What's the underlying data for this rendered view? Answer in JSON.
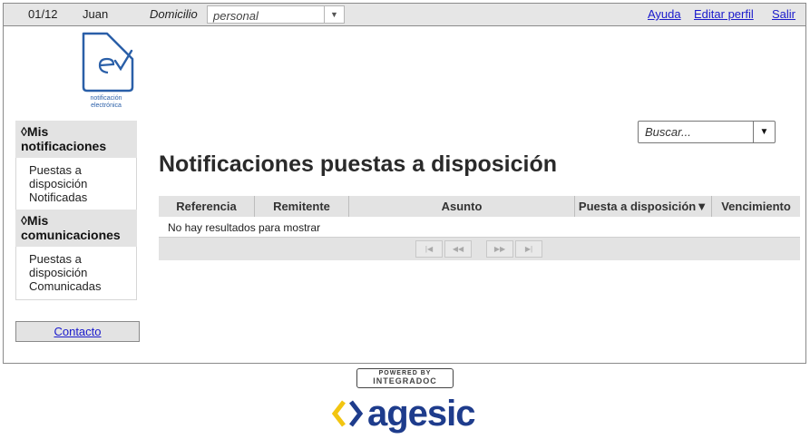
{
  "topbar": {
    "date": "01/12",
    "user": "Juan",
    "domicilio_label": "Domicilio",
    "domicilio_value": "personal",
    "links": [
      "Ayuda",
      "Editar perfil",
      "Salir"
    ]
  },
  "logo": {
    "caption_line1": "notificación",
    "caption_line2": "electrónica"
  },
  "sidebar": {
    "sections": [
      {
        "title_line1": "Mis",
        "title_line2": "notificaciones",
        "items": [
          "Puestas a",
          "disposición",
          "Notificadas"
        ]
      },
      {
        "title_line1": "Mis",
        "title_line2": "comunicaciones",
        "items": [
          "Puestas a",
          "disposición",
          "Comunicadas"
        ]
      }
    ],
    "contact": "Contacto"
  },
  "search": {
    "placeholder": "Buscar..."
  },
  "main": {
    "title": "Notificaciones puestas a disposición",
    "columns": [
      "Referencia",
      "Remitente",
      "Asunto",
      "Puesta a disposición▼",
      "Vencimiento"
    ],
    "empty_message": "No hay resultados para mostrar"
  },
  "footer": {
    "powered_by": "POWERED BY",
    "powered_brand": "INTEGRADOC",
    "agesic": "agesic"
  },
  "colors": {
    "link": "#1a1acc",
    "brand_blue": "#1e3c8c",
    "brand_yellow": "#f2c511",
    "header_gray": "#e3e3e3"
  }
}
